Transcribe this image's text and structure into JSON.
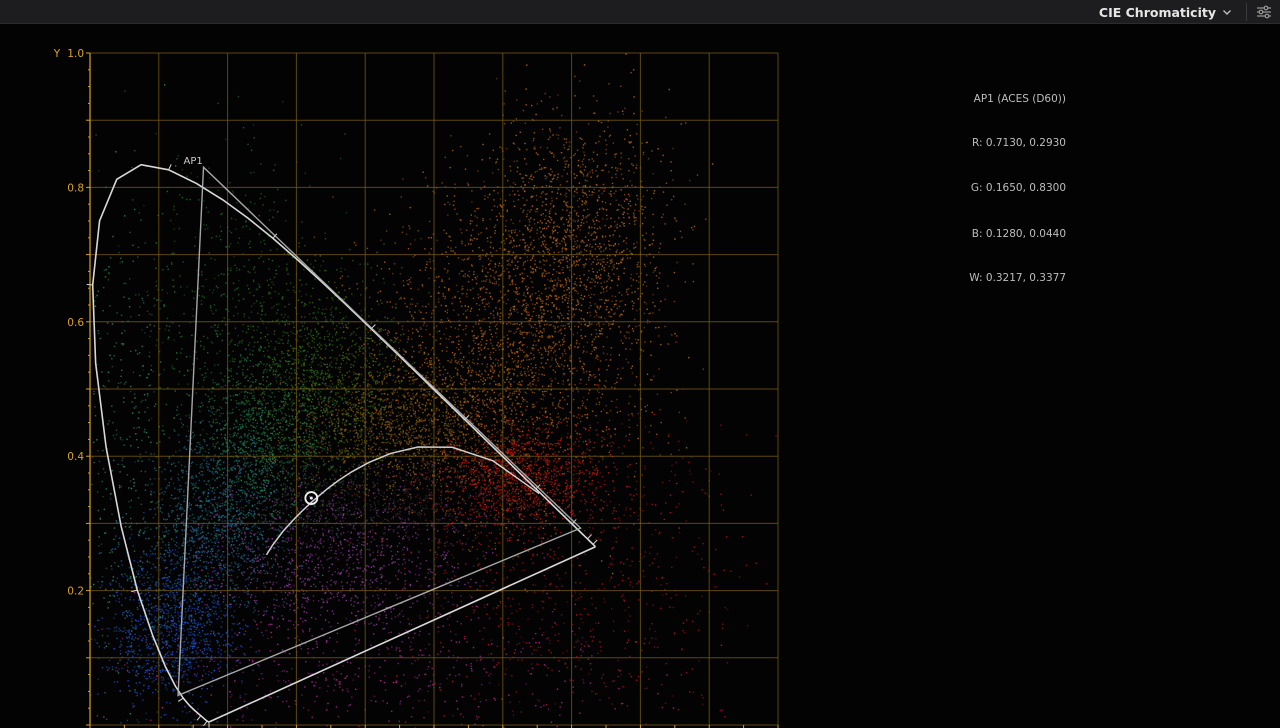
{
  "header": {
    "scope_mode": "CIE Chromaticity",
    "chevron_icon": "chevron-down-icon",
    "settings_icon": "sliders-icon"
  },
  "gamut_info": {
    "title": "AP1 (ACES (D60))",
    "red": "R: 0.7130, 0.2930",
    "green": "G: 0.1650, 0.8300",
    "blue": "B: 0.1280, 0.0440",
    "white": "W: 0.3217, 0.3377"
  },
  "chart_data": {
    "type": "scatter",
    "ylabel": "Y",
    "xlim": [
      0,
      1
    ],
    "ylim": [
      0,
      1
    ],
    "yticks": [
      "1.0",
      "0.8",
      "0.6",
      "0.4",
      "0.2"
    ],
    "ytick_values": [
      1.0,
      0.8,
      0.6,
      0.4,
      0.2
    ],
    "grid": true,
    "grid_color": "#7a5e12",
    "axis_color": "#d9a31c",
    "gamut_label": "AP1",
    "gamut_triangle": [
      [
        0.713,
        0.293
      ],
      [
        0.165,
        0.83
      ],
      [
        0.128,
        0.044
      ]
    ],
    "white_point": [
      0.3217,
      0.3377
    ],
    "spectral_locus": [
      [
        0.1741,
        0.005
      ],
      [
        0.1738,
        0.0049
      ],
      [
        0.1736,
        0.0049
      ],
      [
        0.1733,
        0.0048
      ],
      [
        0.173,
        0.0048
      ],
      [
        0.1726,
        0.0048
      ],
      [
        0.1721,
        0.0048
      ],
      [
        0.1714,
        0.0051
      ],
      [
        0.1703,
        0.0058
      ],
      [
        0.1689,
        0.0069
      ],
      [
        0.1669,
        0.0086
      ],
      [
        0.1644,
        0.0109
      ],
      [
        0.1611,
        0.0138
      ],
      [
        0.1566,
        0.0177
      ],
      [
        0.151,
        0.0227
      ],
      [
        0.144,
        0.0297
      ],
      [
        0.1355,
        0.0399
      ],
      [
        0.1241,
        0.0578
      ],
      [
        0.1096,
        0.0868
      ],
      [
        0.0913,
        0.1327
      ],
      [
        0.0687,
        0.2007
      ],
      [
        0.0454,
        0.295
      ],
      [
        0.0235,
        0.4127
      ],
      [
        0.0082,
        0.5384
      ],
      [
        0.0039,
        0.6548
      ],
      [
        0.0139,
        0.7502
      ],
      [
        0.0389,
        0.812
      ],
      [
        0.0743,
        0.8338
      ],
      [
        0.1142,
        0.8262
      ],
      [
        0.1547,
        0.8059
      ],
      [
        0.1929,
        0.7816
      ],
      [
        0.2296,
        0.7543
      ],
      [
        0.2658,
        0.7243
      ],
      [
        0.3016,
        0.6923
      ],
      [
        0.3373,
        0.6589
      ],
      [
        0.3731,
        0.6245
      ],
      [
        0.4087,
        0.5896
      ],
      [
        0.4441,
        0.5547
      ],
      [
        0.4788,
        0.5202
      ],
      [
        0.5125,
        0.4866
      ],
      [
        0.5448,
        0.4544
      ],
      [
        0.5752,
        0.4242
      ],
      [
        0.6029,
        0.3965
      ],
      [
        0.627,
        0.3725
      ],
      [
        0.6482,
        0.3514
      ],
      [
        0.6658,
        0.334
      ],
      [
        0.6801,
        0.3197
      ],
      [
        0.6915,
        0.3083
      ],
      [
        0.7006,
        0.2993
      ],
      [
        0.7079,
        0.292
      ],
      [
        0.714,
        0.2859
      ],
      [
        0.719,
        0.2809
      ],
      [
        0.723,
        0.277
      ],
      [
        0.726,
        0.274
      ],
      [
        0.7283,
        0.2717
      ],
      [
        0.73,
        0.27
      ],
      [
        0.7311,
        0.2689
      ],
      [
        0.732,
        0.268
      ],
      [
        0.7327,
        0.2673
      ],
      [
        0.7334,
        0.2666
      ],
      [
        0.734,
        0.266
      ],
      [
        0.7344,
        0.2656
      ],
      [
        0.7346,
        0.2654
      ],
      [
        0.7347,
        0.2653
      ]
    ],
    "planckian_locus": [
      [
        0.6528,
        0.3444
      ],
      [
        0.5857,
        0.3931
      ],
      [
        0.5267,
        0.4133
      ],
      [
        0.4765,
        0.4137
      ],
      [
        0.4369,
        0.4041
      ],
      [
        0.4053,
        0.3907
      ],
      [
        0.3805,
        0.3768
      ],
      [
        0.3608,
        0.3636
      ],
      [
        0.3451,
        0.3516
      ],
      [
        0.3221,
        0.3318
      ],
      [
        0.3064,
        0.3166
      ],
      [
        0.2952,
        0.3048
      ],
      [
        0.2806,
        0.2883
      ],
      [
        0.2651,
        0.2673
      ],
      [
        0.2565,
        0.2531
      ]
    ],
    "point_clusters": [
      {
        "center": [
          0.45,
          0.45
        ],
        "spread": [
          0.08,
          0.05
        ],
        "count": 1400,
        "color": "#8a5a10"
      },
      {
        "center": [
          0.6,
          0.55
        ],
        "spread": [
          0.1,
          0.12
        ],
        "count": 2200,
        "color": "#b35e12"
      },
      {
        "center": [
          0.7,
          0.72
        ],
        "spread": [
          0.07,
          0.1
        ],
        "count": 1500,
        "color": "#b8651a"
      },
      {
        "center": [
          0.62,
          0.37
        ],
        "spread": [
          0.06,
          0.04
        ],
        "count": 1100,
        "color": "#c4140a"
      },
      {
        "center": [
          0.68,
          0.25
        ],
        "spread": [
          0.12,
          0.12
        ],
        "count": 900,
        "color": "#b01010"
      },
      {
        "center": [
          0.33,
          0.52
        ],
        "spread": [
          0.06,
          0.08
        ],
        "count": 1200,
        "color": "#2f6e10"
      },
      {
        "center": [
          0.25,
          0.42
        ],
        "spread": [
          0.05,
          0.07
        ],
        "count": 1100,
        "color": "#1f7a4a"
      },
      {
        "center": [
          0.18,
          0.3
        ],
        "spread": [
          0.05,
          0.07
        ],
        "count": 1100,
        "color": "#1a6a8a"
      },
      {
        "center": [
          0.12,
          0.15
        ],
        "spread": [
          0.05,
          0.06
        ],
        "count": 1200,
        "color": "#1a4fc8"
      },
      {
        "center": [
          0.35,
          0.24
        ],
        "spread": [
          0.1,
          0.06
        ],
        "count": 1100,
        "color": "#8e3a9e"
      },
      {
        "center": [
          0.42,
          0.08
        ],
        "spread": [
          0.2,
          0.05
        ],
        "count": 500,
        "color": "#b0238f"
      },
      {
        "center": [
          0.2,
          0.62
        ],
        "spread": [
          0.07,
          0.12
        ],
        "count": 500,
        "color": "#1e6a2a"
      },
      {
        "center": [
          0.05,
          0.4
        ],
        "spread": [
          0.04,
          0.2
        ],
        "count": 500,
        "color": "#2a8a6a"
      },
      {
        "center": [
          0.4,
          0.33
        ],
        "spread": [
          0.1,
          0.03
        ],
        "count": 700,
        "color": "#3a2c3a"
      }
    ]
  }
}
